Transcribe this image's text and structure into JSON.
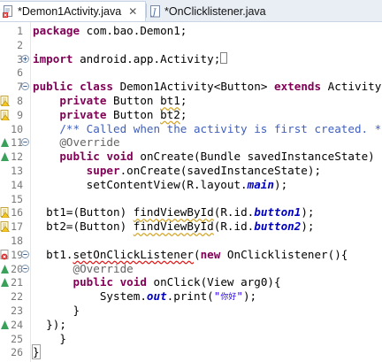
{
  "tabs": [
    {
      "label": "*Demon1Activity.java",
      "close_label": "✕"
    },
    {
      "label": "*OnClicklistener.java"
    }
  ],
  "editor": {
    "lines": [
      {
        "num": "1",
        "segments": [
          [
            "kw",
            "package"
          ],
          [
            "n",
            " com.bao.Demon1;"
          ]
        ]
      },
      {
        "num": "2",
        "segments": []
      },
      {
        "num": "3",
        "segments": [
          [
            "kw",
            "import"
          ],
          [
            "n",
            " android.app.Activity;"
          ]
        ],
        "trail_box": true
      },
      {
        "num": "6",
        "segments": []
      },
      {
        "num": "7",
        "segments": [
          [
            "kw",
            "public"
          ],
          [
            "n",
            " "
          ],
          [
            "kw",
            "class"
          ],
          [
            "n",
            " Demon1Activity<Button> "
          ],
          [
            "kw",
            "extends"
          ],
          [
            "n",
            " Activity "
          ],
          [
            "brk",
            "{"
          ]
        ]
      },
      {
        "num": "8",
        "segments": [
          [
            "n",
            "    "
          ],
          [
            "kw",
            "private"
          ],
          [
            "n",
            " Button "
          ],
          [
            "wv",
            "bt1"
          ],
          [
            "n",
            ";"
          ]
        ]
      },
      {
        "num": "9",
        "segments": [
          [
            "n",
            "    "
          ],
          [
            "kw",
            "private"
          ],
          [
            "n",
            " Button "
          ],
          [
            "wv",
            "bt2"
          ],
          [
            "n",
            ";"
          ]
        ]
      },
      {
        "num": "10",
        "segments": [
          [
            "cm",
            "    /** Called when the activity is first created. */"
          ]
        ]
      },
      {
        "num": "11",
        "segments": [
          [
            "an",
            "    @Override"
          ]
        ]
      },
      {
        "num": "12",
        "segments": [
          [
            "n",
            "    "
          ],
          [
            "kw",
            "public"
          ],
          [
            "n",
            " "
          ],
          [
            "kw",
            "void"
          ],
          [
            "n",
            " onCreate(Bundle savedInstanceState) {"
          ]
        ]
      },
      {
        "num": "13",
        "segments": [
          [
            "n",
            "        "
          ],
          [
            "kw",
            "super"
          ],
          [
            "n",
            ".onCreate(savedInstanceState);"
          ]
        ]
      },
      {
        "num": "14",
        "segments": [
          [
            "n",
            "        setContentView(R.layout."
          ],
          [
            "fd",
            "main"
          ],
          [
            "n",
            ");"
          ]
        ]
      },
      {
        "num": "15",
        "segments": []
      },
      {
        "num": "16",
        "segments": [
          [
            "n",
            "  bt1=(Button) "
          ],
          [
            "wv",
            "findViewById"
          ],
          [
            "n",
            "(R.id."
          ],
          [
            "fd",
            "button1"
          ],
          [
            "n",
            ");"
          ]
        ]
      },
      {
        "num": "17",
        "segments": [
          [
            "n",
            "  bt2=(Button) "
          ],
          [
            "wv",
            "findViewById"
          ],
          [
            "n",
            "(R.id."
          ],
          [
            "fd",
            "button2"
          ],
          [
            "n",
            ");"
          ]
        ]
      },
      {
        "num": "18",
        "segments": []
      },
      {
        "num": "19",
        "segments": [
          [
            "n",
            "  bt1."
          ],
          [
            "wr",
            "setOnClickListener"
          ],
          [
            "n",
            "("
          ],
          [
            "kw",
            "new"
          ],
          [
            "n",
            " OnClicklistener(){"
          ]
        ]
      },
      {
        "num": "20",
        "segments": [
          [
            "an",
            "      @Override"
          ]
        ]
      },
      {
        "num": "21",
        "segments": [
          [
            "n",
            "      "
          ],
          [
            "kw",
            "public"
          ],
          [
            "n",
            " "
          ],
          [
            "kw",
            "void"
          ],
          [
            "n",
            " onClick(View arg0){"
          ]
        ]
      },
      {
        "num": "22",
        "segments": [
          [
            "n",
            "          System."
          ],
          [
            "fd",
            "out"
          ],
          [
            "n",
            ".print("
          ],
          [
            "st",
            "\""
          ],
          [
            "cjk",
            "你好"
          ],
          [
            "st",
            "\""
          ],
          [
            "n",
            ");"
          ]
        ]
      },
      {
        "num": "23",
        "segments": [
          [
            "n",
            "      }"
          ]
        ]
      },
      {
        "num": "24",
        "segments": [
          [
            "n",
            "  });"
          ]
        ]
      },
      {
        "num": "25",
        "segments": [
          [
            "n",
            "    }"
          ]
        ]
      },
      {
        "num": "26",
        "segments": [
          [
            "brk",
            "}"
          ]
        ]
      }
    ]
  },
  "markers": {
    "3": {
      "fold": "expand"
    },
    "7": {
      "fold": "collapse"
    },
    "8": {
      "icon": "warning-icon"
    },
    "9": {
      "icon": "warning-icon"
    },
    "11": {
      "icon": "override-icon",
      "fold": "collapse"
    },
    "12": {
      "icon": "override-icon"
    },
    "16": {
      "icon": "warning-icon"
    },
    "17": {
      "icon": "warning-icon"
    },
    "19": {
      "icon": "error-icon",
      "fold": "collapse"
    },
    "20": {
      "icon": "override-icon",
      "fold": "collapse"
    },
    "21": {
      "icon": "override-icon"
    },
    "24": {
      "icon": "override-icon"
    }
  },
  "colors": {
    "keyword": "#7f0055",
    "comment": "#3f5fbf",
    "annotation": "#646464",
    "string": "#2a00ff",
    "field": "#0000c0",
    "line_number": "#787878",
    "warning_underline": "#d4a82e",
    "error_underline": "#e02020"
  }
}
